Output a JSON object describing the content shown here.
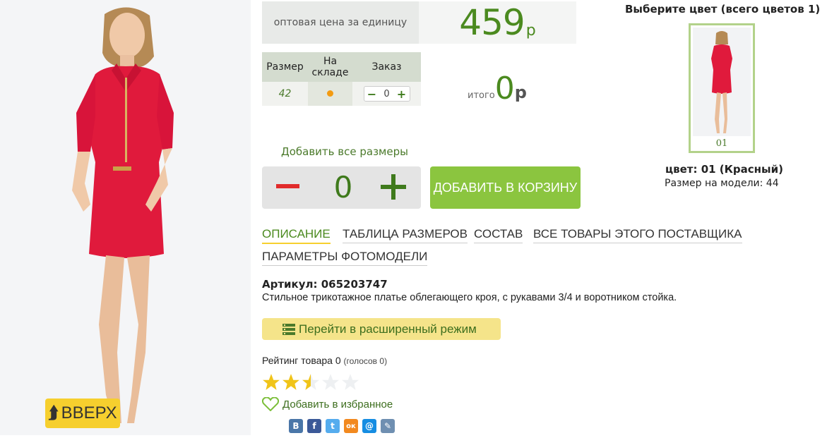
{
  "photo": {
    "back_to_top_label": "ВВЕРХ"
  },
  "price": {
    "label": "оптовая цена за единицу",
    "value": "459",
    "currency": "р"
  },
  "size_table": {
    "headers": [
      "Размер",
      "На складе",
      "Заказ"
    ],
    "rows": [
      {
        "size": "42",
        "qty": "0"
      }
    ]
  },
  "total": {
    "label": "итого",
    "value": "0",
    "currency": "р"
  },
  "add_all_sizes": "Добавить все размеры",
  "quantity": {
    "value": "0"
  },
  "add_to_cart": "ДОБАВИТЬ В КОРЗИНУ",
  "tabs": [
    {
      "label": "ОПИСАНИЕ"
    },
    {
      "label": "ТАБЛИЦА РАЗМЕРОВ"
    },
    {
      "label": "СОСТАВ"
    },
    {
      "label": "ВСЕ ТОВАРЫ ЭТОГО ПОСТАВЩИКА"
    },
    {
      "label": "ПАРАМЕТРЫ ФОТОМОДЕЛИ"
    }
  ],
  "article": "Артикул: 065203747",
  "description": "Стильное трикотажное платье облегающего кроя, с рукавами 3/4 и воротником стойка.",
  "extended_mode": "Перейти в расширенный режим",
  "rating": {
    "label": "Рейтинг товара 0",
    "votes": "(голосов 0)",
    "stars_filled": 2.5,
    "stars_total": 5
  },
  "favorite": "Добавить в избранное",
  "social": [
    {
      "icon": "vk-icon",
      "glyph": "В",
      "color": "#4a76a8"
    },
    {
      "icon": "facebook-icon",
      "glyph": "f",
      "color": "#3b5998"
    },
    {
      "icon": "twitter-icon",
      "glyph": "t",
      "color": "#55acee"
    },
    {
      "icon": "odnoklassniki-icon",
      "glyph": "ок",
      "color": "#f2891f"
    },
    {
      "icon": "mailru-icon",
      "glyph": "@",
      "color": "#168de2"
    },
    {
      "icon": "livejournal-icon",
      "glyph": "✎",
      "color": "#6f8fb1"
    }
  ],
  "colors": {
    "title": "Выберите цвет (всего цветов 1)",
    "items": [
      {
        "code": "01"
      }
    ],
    "selected": "цвет: 01 (Красный)",
    "model_size": "Размер на модели: 44"
  },
  "theme": {
    "accent_green": "#8bc53f",
    "dark_green": "#4b8a1f",
    "yellow": "#f6cf2e",
    "dress_red": "#e01a3c"
  }
}
